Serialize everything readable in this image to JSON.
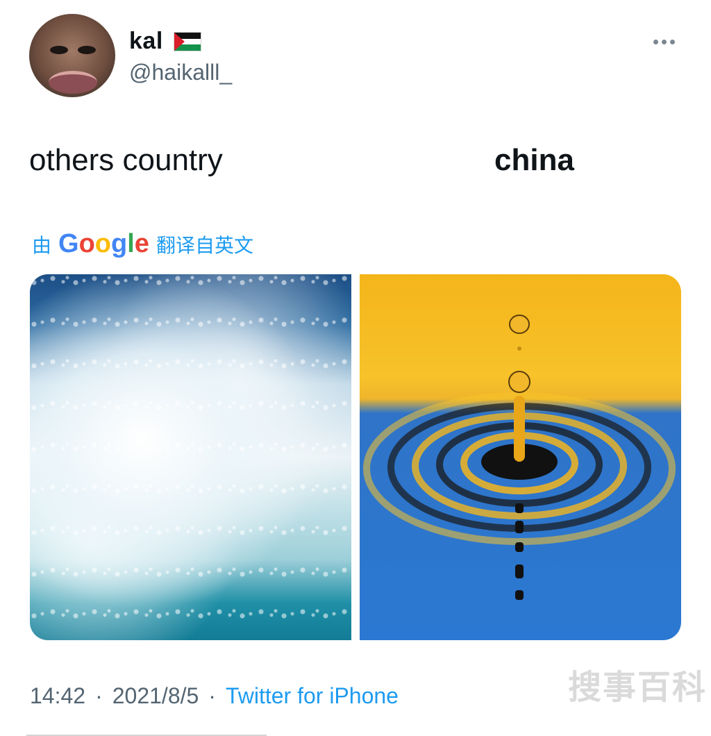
{
  "author": {
    "display_name": "kal",
    "flag_icon": "palestine-flag-icon",
    "handle": "@haikalll_"
  },
  "tweet": {
    "left_text": "others country",
    "right_text": "china"
  },
  "translation": {
    "prefix": "由",
    "google_letters": [
      "G",
      "o",
      "o",
      "g",
      "l",
      "e"
    ],
    "suffix": "翻译自英文"
  },
  "meta": {
    "time": "14:42",
    "separator": "·",
    "date": "2021/8/5",
    "source": "Twitter for iPhone"
  },
  "watermark": "搜事百科",
  "colors": {
    "link": "#1d9bf0",
    "secondary_text": "#536471",
    "primary_text": "#0f1419"
  }
}
